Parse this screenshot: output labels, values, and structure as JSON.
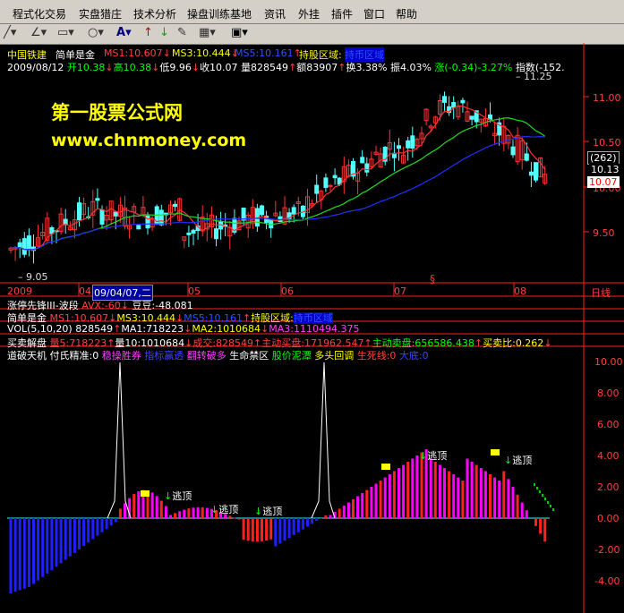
{
  "menu": [
    "程式化交易",
    "实盘猎庄",
    "技术分析",
    "操盘训练基地",
    "资讯",
    "外挂",
    "插件",
    "窗口",
    "帮助"
  ],
  "toolbar": {
    "text_tool": "A",
    "text_tool_arrow": "▾"
  },
  "main_header": {
    "stock_name": "中国铁建",
    "indicator_name": "简单是金",
    "ms1": "MS1:10.607",
    "ms3": "MS3:10.444",
    "ms5": "MS5:10.161",
    "hold_zone": "持股区域:",
    "zone_value": "持币区域"
  },
  "ohlc_row": {
    "date": "2009/08/12",
    "open": "开10.38",
    "high": "高10.38",
    "low": "低9.96",
    "close": "收10.07",
    "volume": "量828549",
    "amount": "额83907",
    "turnover": "换3.38%",
    "amplitude": "振4.03%",
    "change": "涨(-0.34)-3.27%",
    "index": "指数(-152."
  },
  "watermark": {
    "title": "第一股票公式网",
    "url": "www.chnmoney.com"
  },
  "price_axis": {
    "ticks": [
      "11.00",
      "10.50",
      "10.00",
      "9.50"
    ],
    "box1": "(262)",
    "box2": "10.13",
    "box3": "10.07"
  },
  "price_labels": {
    "high": "11.25",
    "low": "9.05",
    "event_marker": "§"
  },
  "date_axis": {
    "labels": [
      "2009",
      "04",
      "09/04/07,二",
      "05",
      "06",
      "07",
      "08"
    ],
    "period": "日线"
  },
  "sub_panels": {
    "p1": {
      "name": "涨停先锋III-波段",
      "avx": "AVX:-60",
      "doudou": "豆豆:-48.081"
    },
    "p2": {
      "name": "简单是金",
      "ms1": "MS1:10.607",
      "ms3": "MS3:10.444",
      "ms5": "MS5:10.161",
      "hold": "持股区域:",
      "zone": "持币区域"
    },
    "p3": {
      "name": "VOL(5,10,20)",
      "v": "828549",
      "ma1": "MA1:718223",
      "ma2": "MA2:1010684",
      "ma3": "MA3:1110494.375"
    },
    "p4": {
      "name": "买卖解盘",
      "l1": "量5:718223",
      "l2": "量10:1010684",
      "l3": "成交:828549",
      "l4": "主动买盘:171962.547",
      "l5": "主动卖盘:656586.438",
      "l6": "买卖比:0.262"
    },
    "p5": {
      "name": "道破天机",
      "fu": "付氏精准:0",
      "s1": "稳操胜券",
      "s2": "指标赢透",
      "s3": "翻转破多",
      "s4": "生命禁区",
      "s5": "股价泥潭",
      "s6": "多头回调",
      "s7": "生死线:0",
      "s8": "大底:0"
    }
  },
  "osc_axis": [
    "10.00",
    "8.00",
    "6.00",
    "4.00",
    "2.00",
    "0.00",
    "-2.00",
    "-4.00"
  ],
  "osc_labels": [
    "逃顶",
    "逃顶",
    "逃顶",
    "逃顶",
    "逃顶"
  ],
  "colors": {
    "up": "#ff3232",
    "down": "#54ffff",
    "ma_red": "#ff3030",
    "ma_green": "#22dd22",
    "ma_blue": "#2030ff",
    "magenta": "#ff00ff",
    "red": "#ff2020",
    "blue": "#2020ff",
    "green": "#00cc00",
    "yellow": "#ffff00"
  }
}
